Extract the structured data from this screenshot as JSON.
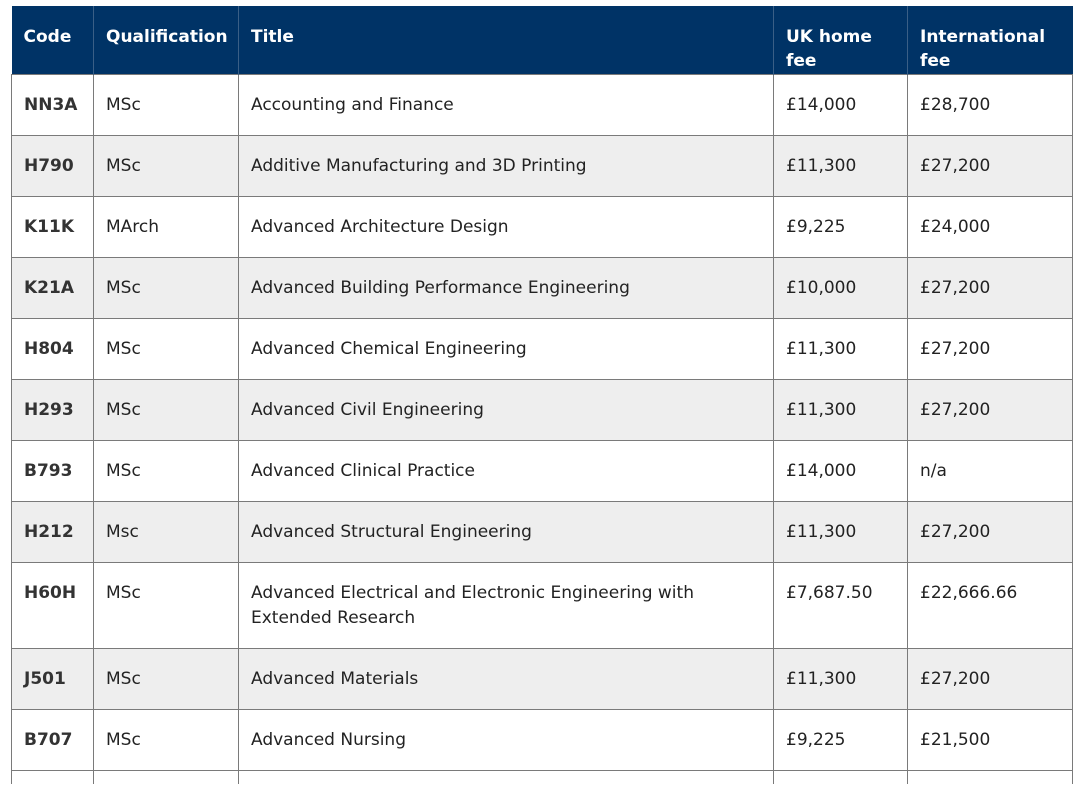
{
  "table": {
    "headers": {
      "code": "Code",
      "qualification": "Qualification",
      "title": "Title",
      "uk_fee_line1": "UK home",
      "uk_fee_line2": "fee",
      "intl_fee_line1": "International",
      "intl_fee_line2": "fee"
    },
    "rows": [
      {
        "code": "NN3A",
        "qualification": "MSc",
        "title": "Accounting and Finance",
        "uk_fee": "£14,000",
        "intl_fee": "£28,700"
      },
      {
        "code": "H790",
        "qualification": "MSc",
        "title": "Additive Manufacturing and 3D Printing",
        "uk_fee": "£11,300",
        "intl_fee": "£27,200"
      },
      {
        "code": "K11K",
        "qualification": "MArch",
        "title": "Advanced Architecture Design",
        "uk_fee": "£9,225",
        "intl_fee": "£24,000"
      },
      {
        "code": "K21A",
        "qualification": "MSc",
        "title": "Advanced Building Performance Engineering",
        "uk_fee": "£10,000",
        "intl_fee": "£27,200"
      },
      {
        "code": "H804",
        "qualification": "MSc",
        "title": "Advanced Chemical Engineering",
        "uk_fee": "£11,300",
        "intl_fee": "£27,200"
      },
      {
        "code": "H293",
        "qualification": "MSc",
        "title": "Advanced Civil Engineering",
        "uk_fee": "£11,300",
        "intl_fee": "£27,200"
      },
      {
        "code": "B793",
        "qualification": "MSc",
        "title": "Advanced Clinical Practice",
        "uk_fee": "£14,000",
        "intl_fee": "n/a"
      },
      {
        "code": "H212",
        "qualification": "Msc",
        "title": "Advanced Structural Engineering",
        "uk_fee": "£11,300",
        "intl_fee": "£27,200"
      },
      {
        "code": "H60H",
        "qualification": "MSc",
        "title_line1": "Advanced Electrical and Electronic Engineering with",
        "title_line2": "Extended Research",
        "uk_fee": "£7,687.50",
        "intl_fee": "£22,666.66"
      },
      {
        "code": "J501",
        "qualification": "MSc",
        "title": "Advanced Materials",
        "uk_fee": "£11,300",
        "intl_fee": "£27,200"
      },
      {
        "code": "B707",
        "qualification": "MSc",
        "title": "Advanced Nursing",
        "uk_fee": "£9,225",
        "intl_fee": "£21,500"
      }
    ]
  },
  "colors": {
    "header_bg": "#003366",
    "header_text": "#ffffff",
    "row_alt_bg": "#eeeeee",
    "border": "#7a7a7a"
  }
}
